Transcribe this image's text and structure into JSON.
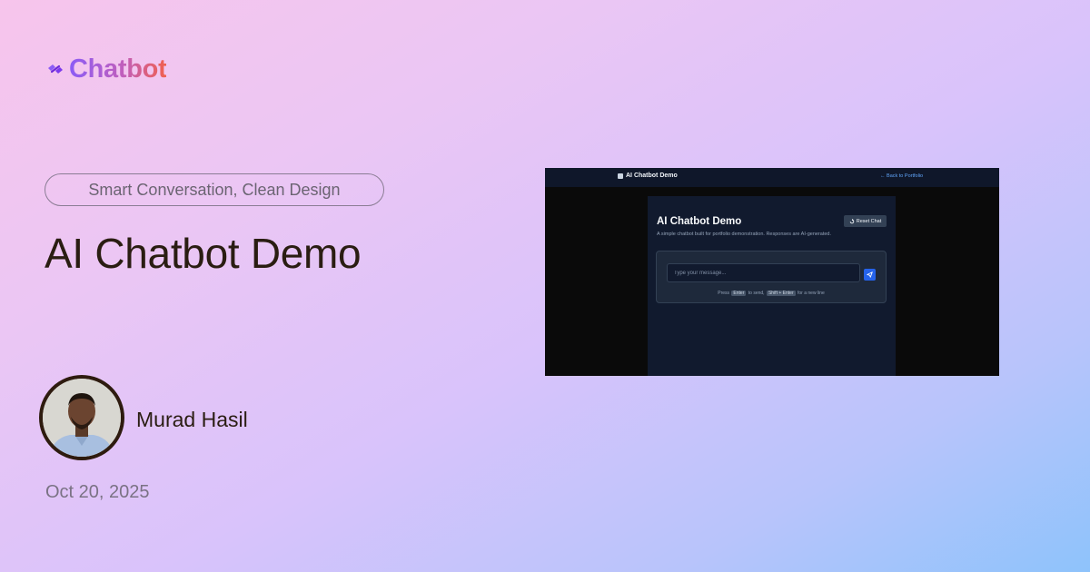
{
  "brand": {
    "name": "Chatbot",
    "icon": "link-icon",
    "colors": [
      "#8b5cf6",
      "#f0604f"
    ]
  },
  "tagline": "Smart Conversation, Clean Design",
  "title": "AI Chatbot Demo",
  "author": {
    "name": "Murad Hasil",
    "avatar": "author-photo"
  },
  "date": "Oct 20, 2025",
  "screenshot": {
    "nav": {
      "title": "AI Chatbot Demo",
      "icon": "robot-icon",
      "back_link": "← Back to Portfolio"
    },
    "panel": {
      "title": "AI Chatbot Demo",
      "subtitle": "A simple chatbot built for portfolio demonstration. Responses are AI-generated.",
      "reset_label": "Reset Chat",
      "input_placeholder": "Type your message...",
      "hint": {
        "prefix": "Press",
        "key1": "Enter",
        "middle": "to send,",
        "key2": "Shift + Enter",
        "suffix": "for a new line"
      }
    }
  }
}
